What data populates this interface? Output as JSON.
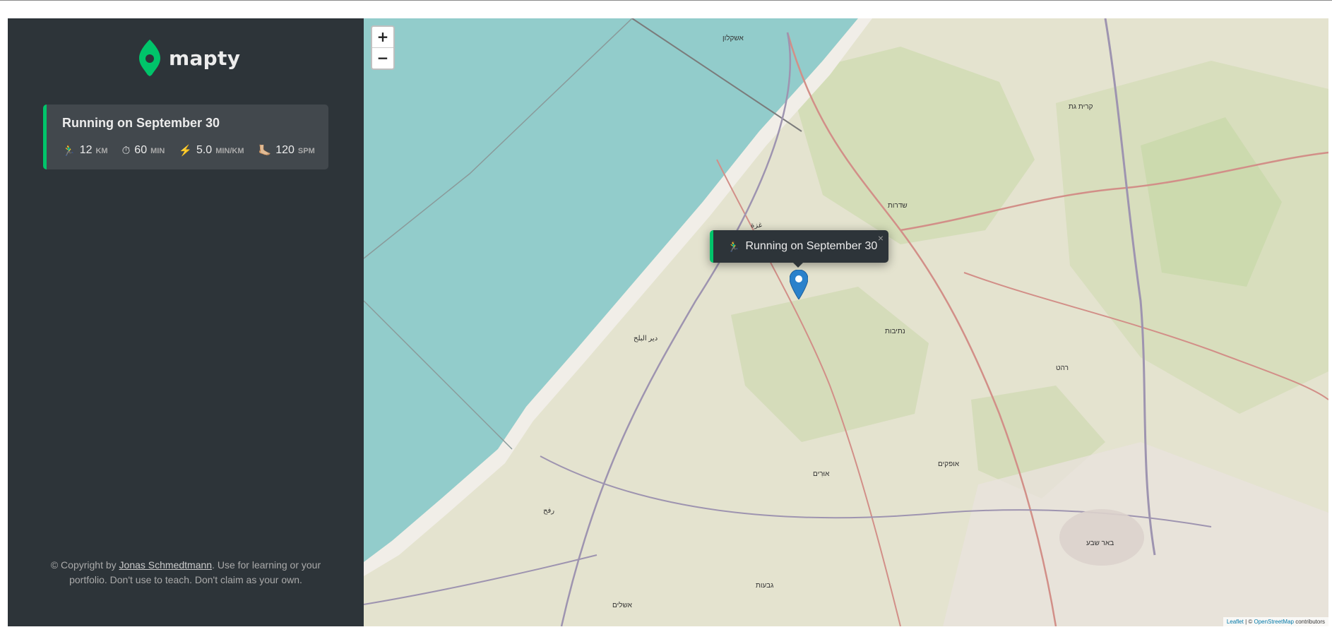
{
  "app": {
    "name": "mapty"
  },
  "workout": {
    "title": "Running on September 30",
    "details": [
      {
        "icon": "🏃‍♂️",
        "value": "12",
        "unit": "km"
      },
      {
        "icon": "⏱",
        "value": "60",
        "unit": "min"
      },
      {
        "icon": "⚡️",
        "value": "5.0",
        "unit": "min/km"
      },
      {
        "icon": "🦶🏼",
        "value": "120",
        "unit": "spm"
      }
    ]
  },
  "copyright": {
    "prefix": "© Copyright by ",
    "author": "Jonas Schmedtmann",
    "suffix": ". Use for learning or your portfolio. Don't use to teach. Don't claim as your own."
  },
  "map": {
    "zoom_in": "+",
    "zoom_out": "−",
    "popup": {
      "icon": "🏃‍♂️",
      "text": "Running on September 30",
      "close": "×"
    },
    "attribution": {
      "leaflet": "Leaflet",
      "sep": " | © ",
      "osm": "OpenStreetMap",
      "suffix": " contributors"
    },
    "labels": [
      "אשקלון",
      "קרית גת",
      "שדרות",
      "נתיבות",
      "רהט",
      "באר שבע",
      "אופקים",
      "غزة",
      "دير البلح",
      "رفح",
      "אשלים",
      "גבעות",
      "אוּרִים"
    ]
  },
  "colors": {
    "sidebar": "#2d3439",
    "card": "#42484d",
    "accent": "#00c46a",
    "sea": "#92cccb",
    "land": "#e4e3cf"
  }
}
